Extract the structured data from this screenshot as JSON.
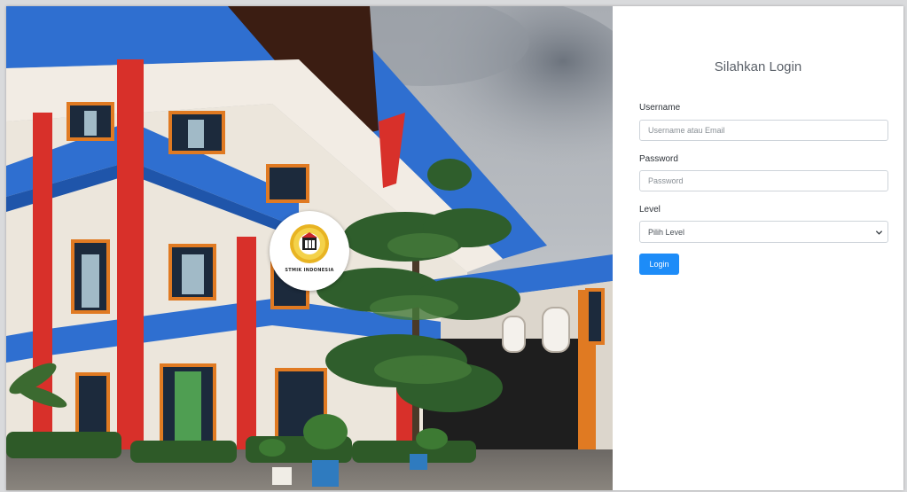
{
  "login": {
    "title": "Silahkan Login",
    "username": {
      "label": "Username",
      "placeholder": "Username atau Email"
    },
    "password": {
      "label": "Password",
      "placeholder": "Password"
    },
    "level": {
      "label": "Level",
      "selected": "Pilih Level"
    },
    "button_label": "Login"
  },
  "hero": {
    "logo_text": "STMIK INDONESIA"
  },
  "colors": {
    "button": "#1d8cf8",
    "building_blue": "#2f6fd0",
    "building_red": "#d8302a",
    "frame_orange": "#e07a22"
  },
  "icons": [
    "chevron-down-icon",
    "campus-logo-icon"
  ]
}
